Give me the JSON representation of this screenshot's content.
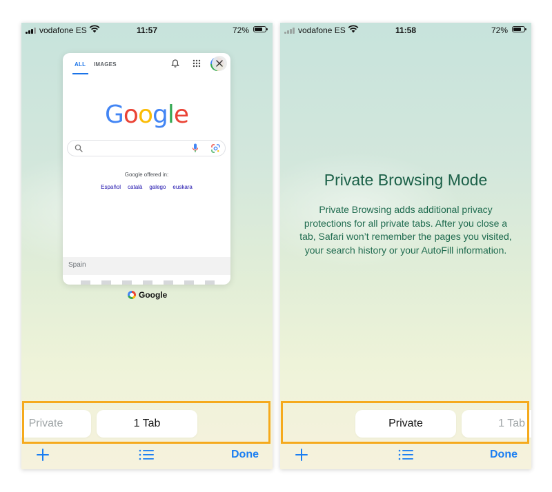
{
  "colors": {
    "ios_blue": "#1a7ef2",
    "highlight_orange": "#f5aa1d",
    "private_text_green": "#1f6b4f",
    "google_blue": "#4285f4",
    "google_red": "#ea4335",
    "google_yellow": "#fbbc05",
    "google_green": "#34a853"
  },
  "left_screen": {
    "status": {
      "carrier": "vodafone ES",
      "time": "11:57",
      "battery": "72%",
      "battery_level": 0.72
    },
    "card": {
      "tabs": [
        "ALL",
        "IMAGES"
      ],
      "logo": "Google",
      "offered_in": "Google offered in:",
      "languages": [
        "Español",
        "català",
        "galego",
        "euskara"
      ],
      "country": "Spain",
      "page_label": "Google"
    },
    "switcher": {
      "private_label": "Private",
      "tabs_label": "1 Tab",
      "active": "1 Tab"
    },
    "toolbar": {
      "done": "Done"
    }
  },
  "right_screen": {
    "status": {
      "carrier": "vodafone ES",
      "time": "11:58",
      "battery": "72%",
      "battery_level": 0.72
    },
    "title": "Private Browsing Mode",
    "description": "Private Browsing adds additional privacy protections for all private tabs. After you close a tab, Safari won’t remember the pages you visited, your search history or your AutoFill information.",
    "switcher": {
      "private_label": "Private",
      "tabs_label": "1 Tab",
      "active": "Private"
    },
    "toolbar": {
      "done": "Done"
    }
  }
}
